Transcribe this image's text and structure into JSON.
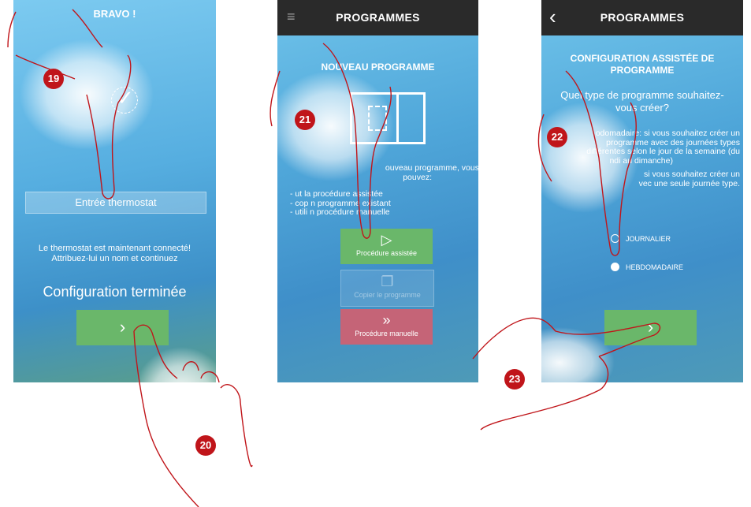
{
  "screen1": {
    "header": "BRAVO !",
    "check_icon": "check-icon",
    "field_value": "Entrée thermostat",
    "message_line1": "Le thermostat est maintenant connecté!",
    "message_line2": "Attribuez-lui un nom et continuez",
    "done_text": "Configuration terminée",
    "next_glyph": "›"
  },
  "screen2": {
    "topbar_title": "PROGRAMMES",
    "menu_icon": "menu-icon",
    "heading": "NOUVEAU PROGRAMME",
    "intro_line1": "ouveau programme, vous",
    "intro_line2": "pouvez:",
    "list": [
      "- ut   la procédure assistée",
      "- cop    n programme existant",
      "- utili   n procédure manuelle"
    ],
    "buttons": [
      {
        "label": "Procédure assistée",
        "icon": "play-icon",
        "glyph": "▷",
        "state": "enabled",
        "color": "#6ab76a"
      },
      {
        "label": "Copier le programme",
        "icon": "copy-icon",
        "glyph": "❐",
        "state": "disabled",
        "color": "#9bc4dd"
      },
      {
        "label": "Procédure manuelle",
        "icon": "fast-forward-icon",
        "glyph": "»",
        "state": "enabled",
        "color": "#c56477"
      }
    ]
  },
  "screen3": {
    "topbar_title": "PROGRAMMES",
    "back_glyph": "‹",
    "heading_line1": "CONFIGURATION ASSISTÉE DE",
    "heading_line2": "PROGRAMME",
    "question_line1": "Quel type de programme souhaitez-",
    "question_line2": "vous créer?",
    "desc": [
      "odomadaire: si vous souhaitez créer un",
      "programme avec des journées types",
      "différentes selon le jour de la semaine (du",
      "ndi au dimanche)",
      "si vous souhaitez créer un",
      "vec une seule journée type."
    ],
    "options": [
      {
        "label": "JOURNALIER",
        "selected": false
      },
      {
        "label": "HEBDOMADAIRE",
        "selected": true
      }
    ],
    "next_glyph": "›"
  },
  "badges": [
    "19",
    "20",
    "21",
    "22",
    "23"
  ],
  "colors": {
    "badge": "#c0151a",
    "green_button": "#6ab76a",
    "red_button": "#c56477",
    "topbar": "#2a2a2a",
    "hand_outline": "#c0151a"
  }
}
